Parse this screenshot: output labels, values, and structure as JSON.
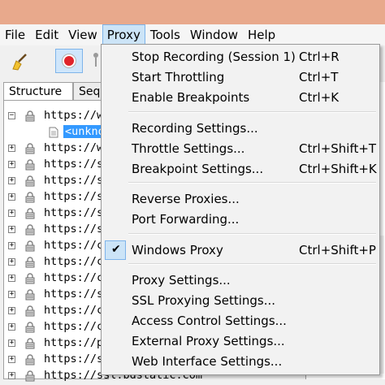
{
  "menubar": {
    "items": [
      "File",
      "Edit",
      "View",
      "Proxy",
      "Tools",
      "Window",
      "Help"
    ]
  },
  "tabs": {
    "structure": "Structure",
    "sequence": "Seq"
  },
  "tree": {
    "hosts": [
      "https://w",
      "https://w",
      "https://s",
      "https://s",
      "https://s",
      "https://s",
      "https://s",
      "https://c",
      "https://c",
      "https://c",
      "https://s",
      "https://c",
      "https://c",
      "https://p",
      "https://s",
      "https://ssl.bdstatic.com"
    ],
    "child_label": "<unkno"
  },
  "proxy_menu": {
    "items": [
      {
        "label": "Stop Recording (Session 1)",
        "shortcut": "Ctrl+R"
      },
      {
        "label": "Start Throttling",
        "shortcut": "Ctrl+T"
      },
      {
        "label": "Enable Breakpoints",
        "shortcut": "Ctrl+K"
      },
      {
        "label": "Recording Settings...",
        "shortcut": ""
      },
      {
        "label": "Throttle Settings...",
        "shortcut": "Ctrl+Shift+T"
      },
      {
        "label": "Breakpoint Settings...",
        "shortcut": "Ctrl+Shift+K"
      },
      {
        "label": "Reverse Proxies...",
        "shortcut": ""
      },
      {
        "label": "Port Forwarding...",
        "shortcut": ""
      },
      {
        "label": "Windows Proxy",
        "shortcut": "Ctrl+Shift+P",
        "checked": true
      },
      {
        "label": "Proxy Settings...",
        "shortcut": ""
      },
      {
        "label": "SSL Proxying Settings...",
        "shortcut": ""
      },
      {
        "label": "Access Control Settings...",
        "shortcut": ""
      },
      {
        "label": "External Proxy Settings...",
        "shortcut": ""
      },
      {
        "label": "Web Interface Settings...",
        "shortcut": ""
      }
    ],
    "check_glyph": "✔"
  },
  "icons": {
    "broom": "broom-icon",
    "record": "record-icon",
    "throttle": "throttle-icon",
    "lock": "lock-icon",
    "expand": "expand-icon",
    "document": "document-icon",
    "check": "check-icon"
  },
  "colors": {
    "titlebar": "#e8a98c",
    "menu_highlight": "#cce4f7",
    "record_red": "#e0242b",
    "selection": "#3399ff"
  }
}
